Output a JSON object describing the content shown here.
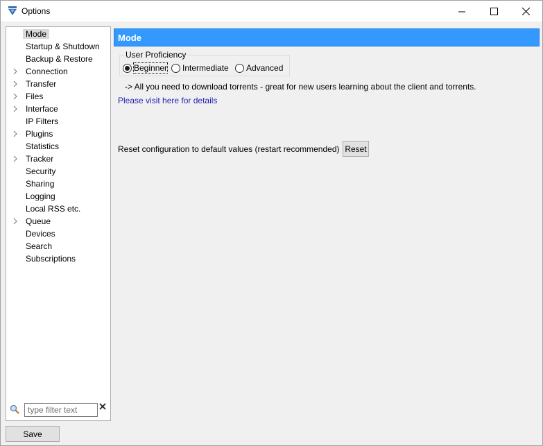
{
  "window": {
    "title": "Options"
  },
  "sidebar": {
    "items": [
      {
        "label": "Mode",
        "expandable": false,
        "selected": true
      },
      {
        "label": "Startup & Shutdown",
        "expandable": false,
        "selected": false
      },
      {
        "label": "Backup & Restore",
        "expandable": false,
        "selected": false
      },
      {
        "label": "Connection",
        "expandable": true,
        "selected": false
      },
      {
        "label": "Transfer",
        "expandable": true,
        "selected": false
      },
      {
        "label": "Files",
        "expandable": true,
        "selected": false
      },
      {
        "label": "Interface",
        "expandable": true,
        "selected": false
      },
      {
        "label": "IP Filters",
        "expandable": false,
        "selected": false
      },
      {
        "label": "Plugins",
        "expandable": true,
        "selected": false
      },
      {
        "label": "Statistics",
        "expandable": false,
        "selected": false
      },
      {
        "label": "Tracker",
        "expandable": true,
        "selected": false
      },
      {
        "label": "Security",
        "expandable": false,
        "selected": false
      },
      {
        "label": "Sharing",
        "expandable": false,
        "selected": false
      },
      {
        "label": "Logging",
        "expandable": false,
        "selected": false
      },
      {
        "label": "Local RSS etc.",
        "expandable": false,
        "selected": false
      },
      {
        "label": "Queue",
        "expandable": true,
        "selected": false
      },
      {
        "label": "Devices",
        "expandable": false,
        "selected": false
      },
      {
        "label": "Search",
        "expandable": false,
        "selected": false
      },
      {
        "label": "Subscriptions",
        "expandable": false,
        "selected": false
      }
    ],
    "filter": {
      "placeholder": "type filter text",
      "value": ""
    }
  },
  "footer": {
    "save_label": "Save"
  },
  "main": {
    "header": "Mode",
    "proficiency": {
      "legend": "User Proficiency",
      "options": [
        {
          "label": "Beginner",
          "checked": true
        },
        {
          "label": "Intermediate",
          "checked": false
        },
        {
          "label": "Advanced",
          "checked": false
        }
      ]
    },
    "description": "-> All you need to download torrents - great for new users learning about the client and torrents.",
    "details_link": "Please visit here for details",
    "reset": {
      "label": "Reset configuration to default values (restart recommended)",
      "button": "Reset"
    }
  },
  "colors": {
    "header_bg": "#3399ff",
    "link": "#1f1fb0",
    "selection": "#d9d9d9"
  }
}
